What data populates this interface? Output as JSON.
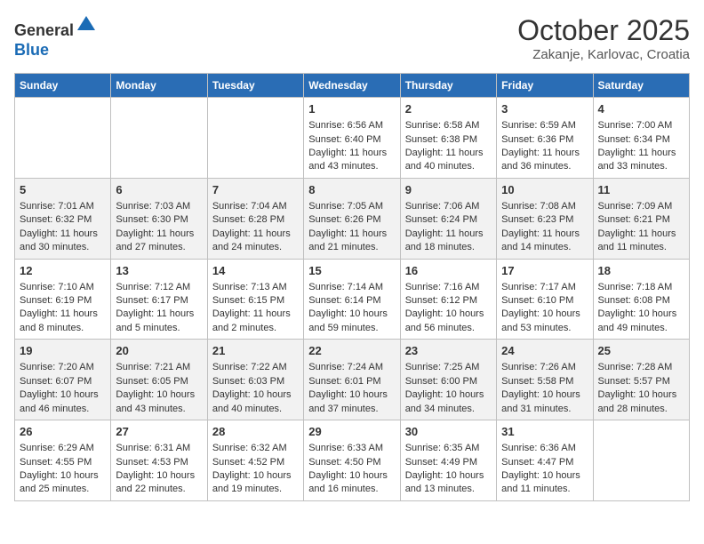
{
  "header": {
    "logo_line1": "General",
    "logo_line2": "Blue",
    "title": "October 2025",
    "subtitle": "Zakanje, Karlovac, Croatia"
  },
  "days_of_week": [
    "Sunday",
    "Monday",
    "Tuesday",
    "Wednesday",
    "Thursday",
    "Friday",
    "Saturday"
  ],
  "weeks": [
    {
      "cells": [
        {
          "day": "",
          "content": ""
        },
        {
          "day": "",
          "content": ""
        },
        {
          "day": "",
          "content": ""
        },
        {
          "day": "1",
          "content": "Sunrise: 6:56 AM\nSunset: 6:40 PM\nDaylight: 11 hours and 43 minutes."
        },
        {
          "day": "2",
          "content": "Sunrise: 6:58 AM\nSunset: 6:38 PM\nDaylight: 11 hours and 40 minutes."
        },
        {
          "day": "3",
          "content": "Sunrise: 6:59 AM\nSunset: 6:36 PM\nDaylight: 11 hours and 36 minutes."
        },
        {
          "day": "4",
          "content": "Sunrise: 7:00 AM\nSunset: 6:34 PM\nDaylight: 11 hours and 33 minutes."
        }
      ]
    },
    {
      "cells": [
        {
          "day": "5",
          "content": "Sunrise: 7:01 AM\nSunset: 6:32 PM\nDaylight: 11 hours and 30 minutes."
        },
        {
          "day": "6",
          "content": "Sunrise: 7:03 AM\nSunset: 6:30 PM\nDaylight: 11 hours and 27 minutes."
        },
        {
          "day": "7",
          "content": "Sunrise: 7:04 AM\nSunset: 6:28 PM\nDaylight: 11 hours and 24 minutes."
        },
        {
          "day": "8",
          "content": "Sunrise: 7:05 AM\nSunset: 6:26 PM\nDaylight: 11 hours and 21 minutes."
        },
        {
          "day": "9",
          "content": "Sunrise: 7:06 AM\nSunset: 6:24 PM\nDaylight: 11 hours and 18 minutes."
        },
        {
          "day": "10",
          "content": "Sunrise: 7:08 AM\nSunset: 6:23 PM\nDaylight: 11 hours and 14 minutes."
        },
        {
          "day": "11",
          "content": "Sunrise: 7:09 AM\nSunset: 6:21 PM\nDaylight: 11 hours and 11 minutes."
        }
      ]
    },
    {
      "cells": [
        {
          "day": "12",
          "content": "Sunrise: 7:10 AM\nSunset: 6:19 PM\nDaylight: 11 hours and 8 minutes."
        },
        {
          "day": "13",
          "content": "Sunrise: 7:12 AM\nSunset: 6:17 PM\nDaylight: 11 hours and 5 minutes."
        },
        {
          "day": "14",
          "content": "Sunrise: 7:13 AM\nSunset: 6:15 PM\nDaylight: 11 hours and 2 minutes."
        },
        {
          "day": "15",
          "content": "Sunrise: 7:14 AM\nSunset: 6:14 PM\nDaylight: 10 hours and 59 minutes."
        },
        {
          "day": "16",
          "content": "Sunrise: 7:16 AM\nSunset: 6:12 PM\nDaylight: 10 hours and 56 minutes."
        },
        {
          "day": "17",
          "content": "Sunrise: 7:17 AM\nSunset: 6:10 PM\nDaylight: 10 hours and 53 minutes."
        },
        {
          "day": "18",
          "content": "Sunrise: 7:18 AM\nSunset: 6:08 PM\nDaylight: 10 hours and 49 minutes."
        }
      ]
    },
    {
      "cells": [
        {
          "day": "19",
          "content": "Sunrise: 7:20 AM\nSunset: 6:07 PM\nDaylight: 10 hours and 46 minutes."
        },
        {
          "day": "20",
          "content": "Sunrise: 7:21 AM\nSunset: 6:05 PM\nDaylight: 10 hours and 43 minutes."
        },
        {
          "day": "21",
          "content": "Sunrise: 7:22 AM\nSunset: 6:03 PM\nDaylight: 10 hours and 40 minutes."
        },
        {
          "day": "22",
          "content": "Sunrise: 7:24 AM\nSunset: 6:01 PM\nDaylight: 10 hours and 37 minutes."
        },
        {
          "day": "23",
          "content": "Sunrise: 7:25 AM\nSunset: 6:00 PM\nDaylight: 10 hours and 34 minutes."
        },
        {
          "day": "24",
          "content": "Sunrise: 7:26 AM\nSunset: 5:58 PM\nDaylight: 10 hours and 31 minutes."
        },
        {
          "day": "25",
          "content": "Sunrise: 7:28 AM\nSunset: 5:57 PM\nDaylight: 10 hours and 28 minutes."
        }
      ]
    },
    {
      "cells": [
        {
          "day": "26",
          "content": "Sunrise: 6:29 AM\nSunset: 4:55 PM\nDaylight: 10 hours and 25 minutes."
        },
        {
          "day": "27",
          "content": "Sunrise: 6:31 AM\nSunset: 4:53 PM\nDaylight: 10 hours and 22 minutes."
        },
        {
          "day": "28",
          "content": "Sunrise: 6:32 AM\nSunset: 4:52 PM\nDaylight: 10 hours and 19 minutes."
        },
        {
          "day": "29",
          "content": "Sunrise: 6:33 AM\nSunset: 4:50 PM\nDaylight: 10 hours and 16 minutes."
        },
        {
          "day": "30",
          "content": "Sunrise: 6:35 AM\nSunset: 4:49 PM\nDaylight: 10 hours and 13 minutes."
        },
        {
          "day": "31",
          "content": "Sunrise: 6:36 AM\nSunset: 4:47 PM\nDaylight: 10 hours and 11 minutes."
        },
        {
          "day": "",
          "content": ""
        }
      ]
    }
  ]
}
